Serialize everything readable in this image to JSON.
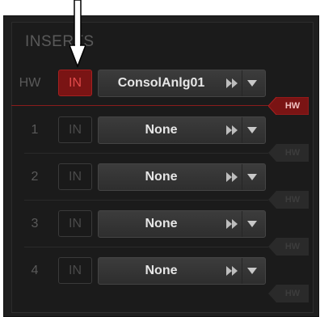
{
  "section_title": "INSERTS",
  "rows": [
    {
      "label": "HW",
      "in_label": "IN",
      "in_active": true,
      "name": "ConsolAnlg01",
      "hw_label": "HW",
      "hw_active": true
    },
    {
      "label": "1",
      "in_label": "IN",
      "in_active": false,
      "name": "None",
      "hw_label": "HW",
      "hw_active": false
    },
    {
      "label": "2",
      "in_label": "IN",
      "in_active": false,
      "name": "None",
      "hw_label": "HW",
      "hw_active": false
    },
    {
      "label": "3",
      "in_label": "IN",
      "in_active": false,
      "name": "None",
      "hw_label": "HW",
      "hw_active": false
    },
    {
      "label": "4",
      "in_label": "IN",
      "in_active": false,
      "name": "None",
      "hw_label": "HW",
      "hw_active": false
    }
  ],
  "icons": {
    "callout": "pointer-arrow-icon",
    "step": "fast-forward-icon",
    "dropdown": "chevron-down-icon"
  },
  "colors": {
    "panel_bg": "#1f1f1f",
    "active_red": "#7a1414",
    "active_text": "#e14a4a",
    "selector_bg": "#363636"
  }
}
